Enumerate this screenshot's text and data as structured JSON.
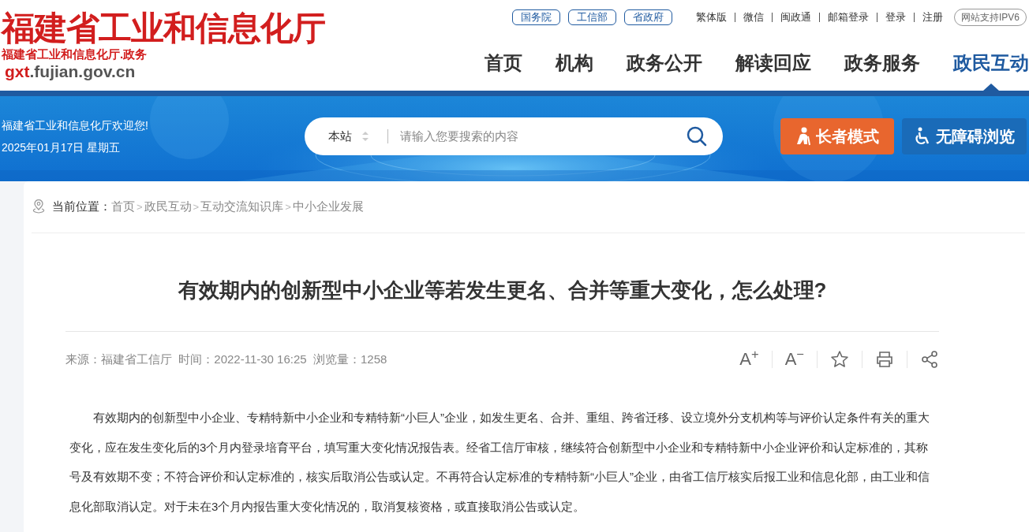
{
  "logo": {
    "title": "福建省工业和信息化厅",
    "subtitle": "福建省工业和信息化厅.政务",
    "domain_highlight": "gxt",
    "domain_rest": ".fujian.gov.cn"
  },
  "top_links": [
    {
      "label": "国务院",
      "kind": "pill"
    },
    {
      "label": "工信部",
      "kind": "pill"
    },
    {
      "label": "省政府",
      "kind": "pill"
    }
  ],
  "utility_links": [
    "繁体版",
    "微信",
    "闽政通",
    "邮箱登录",
    "登录",
    "注册"
  ],
  "ipv6_badge": "网站支持IPV6",
  "nav": [
    {
      "label": "首页",
      "selected": false
    },
    {
      "label": "机构",
      "selected": false
    },
    {
      "label": "政务公开",
      "selected": false
    },
    {
      "label": "解读回应",
      "selected": false
    },
    {
      "label": "政务服务",
      "selected": false
    },
    {
      "label": "政民互动",
      "selected": true
    }
  ],
  "banner": {
    "welcome": "福建省工业和信息化厅欢迎您!",
    "date": "2025年01月17日 星期五",
    "search": {
      "scope": "本站",
      "placeholder": "请输入您要搜索的内容"
    },
    "buttons": [
      {
        "label": "长者模式",
        "kind": "elder"
      },
      {
        "label": "无障碍浏览",
        "kind": "accessible"
      }
    ]
  },
  "breadcrumb": {
    "label": "当前位置：",
    "items": [
      "首页",
      "政民互动",
      "互动交流知识库",
      "中小企业发展"
    ],
    "separator": ">"
  },
  "article": {
    "title": "有效期内的创新型中小企业等若发生更名、合并等重大变化，怎么处理?",
    "meta": "来源：福建省工信厅  时间：2022-11-30 16:25  浏览量：1258",
    "tools": [
      {
        "kind": "font_larger",
        "label": "A$^{+}$"
      },
      {
        "kind": "font_smaller",
        "label": "A$^{−}$"
      },
      {
        "kind": "favorite"
      },
      {
        "kind": "print"
      },
      {
        "kind": "share"
      }
    ],
    "body": "有效期内的创新型中小企业、专精特新中小企业和专精特新“小巨人”企业，如发生更名、合并、重组、跨省迁移、设立境外分支机构等与评价认定条件有关的重大变化，应在发生变化后的3个月内登录培育平台，填写重大变化情况报告表。经省工信厅审核，继续符合创新型中小企业和专精特新中小企业评价和认定标准的，其称号及有效期不变；不符合评价和认定标准的，核实后取消公告或认定。不再符合认定标准的专精特新“小巨人”企业，由省工信厅核实后报工业和信息化部，由工业和信息化部取消认定。对于未在3个月内报告重大变化情况的，取消复核资格，或直接取消公告或认定。"
  }
}
